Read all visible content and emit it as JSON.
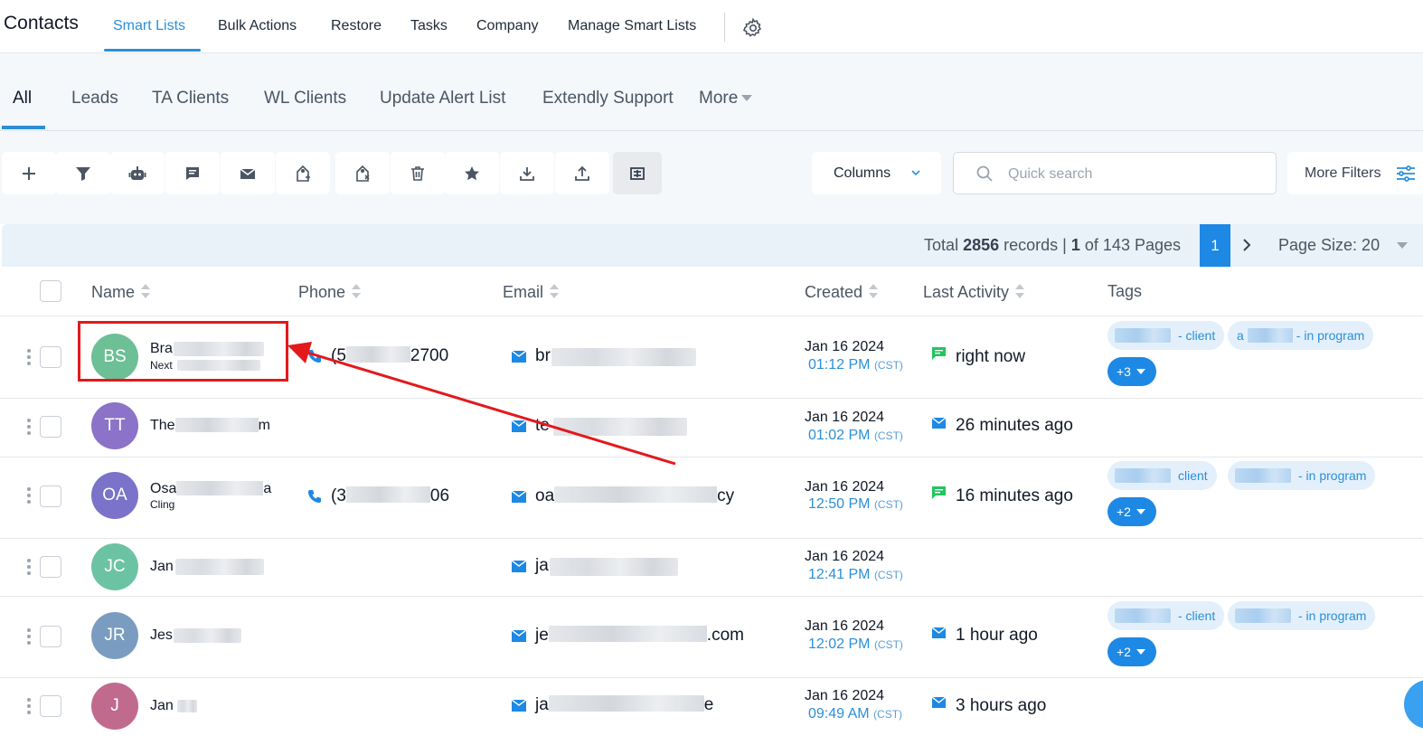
{
  "topnav": {
    "title": "Contacts",
    "items": [
      "Smart Lists",
      "Bulk Actions",
      "Restore",
      "Tasks",
      "Company",
      "Manage Smart Lists"
    ]
  },
  "tabs": [
    "All",
    "Leads",
    "TA Clients",
    "WL Clients",
    "Update Alert List",
    "Extendly Support",
    "More"
  ],
  "toolbar": {
    "icons": [
      "plus-icon",
      "filter-icon",
      "robot-icon",
      "message-icon",
      "mail-icon",
      "add-tag-icon",
      "remove-tag-icon",
      "trash-icon",
      "star-icon",
      "download-icon",
      "upload-icon",
      "merge-icon"
    ],
    "columns_label": "Columns",
    "search_placeholder": "Quick search",
    "more_filters_label": "More Filters"
  },
  "pager": {
    "total_prefix": "Total",
    "total_count": "2856",
    "records_label": "records |",
    "current_page": "1",
    "of_pages": "of 143 Pages",
    "page_button": "1",
    "page_size": "Page Size: 20"
  },
  "table": {
    "headers": [
      "Name",
      "Phone",
      "Email",
      "Created",
      "Last Activity",
      "Tags"
    ],
    "rows": [
      {
        "initials": "BS",
        "name": "Bra",
        "sub": "Next",
        "phone_start": "(5",
        "phone_end": "2700",
        "email_start": "br",
        "email_end": "",
        "date": "Jan 16 2024",
        "time": "01:12 PM",
        "tz": "(CST)",
        "activity": "right now",
        "activity_icon": "chat-icon",
        "tags": [
          "- client",
          "- in program"
        ],
        "tag_prefix_2": "a",
        "more_tags": "+3"
      },
      {
        "initials": "TT",
        "name": "The",
        "name_end": "m",
        "email_start": "te",
        "date": "Jan 16 2024",
        "time": "01:02 PM",
        "tz": "(CST)",
        "activity": "26 minutes ago",
        "activity_icon": "mail-icon"
      },
      {
        "initials": "OA",
        "name": "Osa",
        "name_end": "a",
        "sub": "Cling",
        "phone_start": "(3",
        "phone_end": "06",
        "email_start": "oa",
        "email_end": "cy",
        "date": "Jan 16 2024",
        "time": "12:50 PM",
        "tz": "(CST)",
        "activity": "16 minutes ago",
        "activity_icon": "chat-icon",
        "tags": [
          "client",
          "- in program"
        ],
        "more_tags": "+2"
      },
      {
        "initials": "JC",
        "name": "Jan",
        "email_start": "ja",
        "date": "Jan 16 2024",
        "time": "12:41 PM",
        "tz": "(CST)"
      },
      {
        "initials": "JR",
        "name": "Jes",
        "email_start": "je",
        "email_end": ".com",
        "date": "Jan 16 2024",
        "time": "12:02 PM",
        "tz": "(CST)",
        "activity": "1 hour ago",
        "activity_icon": "mail-icon",
        "tags": [
          "- client",
          "- in program"
        ],
        "more_tags": "+2"
      },
      {
        "initials": "J",
        "name": "Jan",
        "email_start": "ja",
        "email_end": "e",
        "date": "Jan 16 2024",
        "time": "09:49 AM",
        "tz": "(CST)",
        "activity": "3 hours ago",
        "activity_icon": "mail-icon"
      }
    ]
  },
  "colors": {
    "accent": "#2b8fd8",
    "primary_button": "#1e88e5",
    "annotation": "#e3191c",
    "avatar_bs": "#6dbf95",
    "avatar_tt": "#8c72c8",
    "avatar_oa": "#7b73c9",
    "avatar_jc": "#6cc3a3",
    "avatar_jr": "#7a9cc0",
    "avatar_j": "#c06b8e"
  }
}
